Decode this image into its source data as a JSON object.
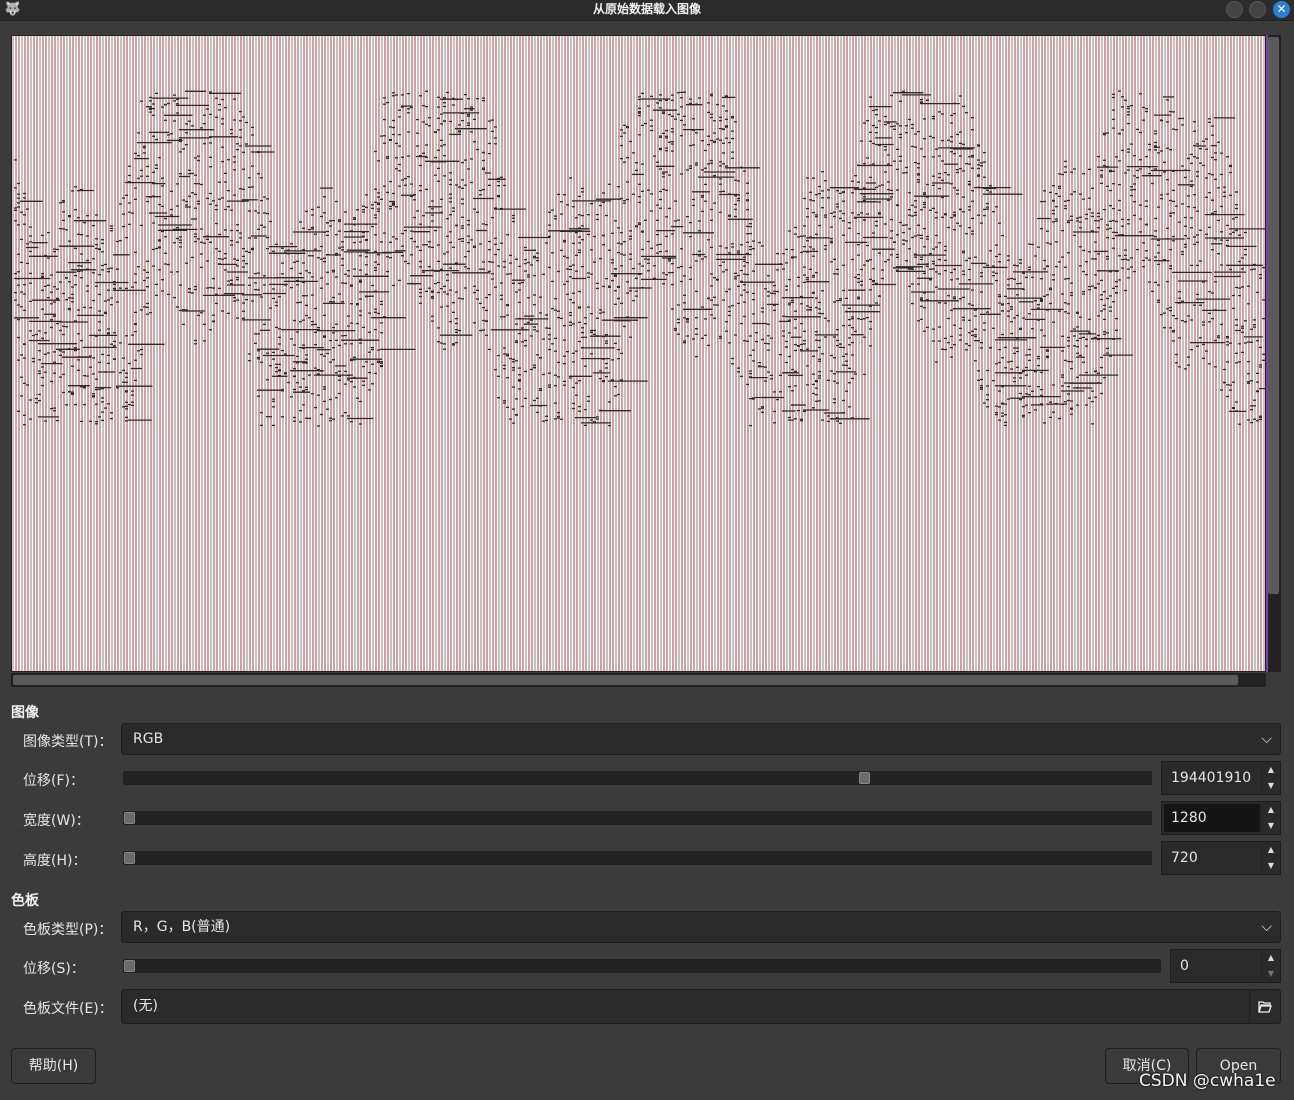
{
  "window": {
    "title": "从原始数据载入图像",
    "app_icon": "gimp-wilber-icon",
    "buttons": [
      "minimize",
      "maximize",
      "close"
    ],
    "close_symbol": "✕"
  },
  "preview": {
    "description": "raw-data-preview",
    "stripe_colors": [
      "#ffffff",
      "#8b0000",
      "#2a2a2a"
    ]
  },
  "image_section": {
    "title": "图像",
    "image_type": {
      "label": "图像类型(T)：",
      "value": "RGB",
      "chevron": "⌵"
    },
    "offset": {
      "label": "位移(F)：",
      "value": "194401910",
      "slider_fraction": 0.72
    },
    "width": {
      "label": "宽度(W)：",
      "value": "1280",
      "slider_fraction": 0.0
    },
    "height": {
      "label": "高度(H)：",
      "value": "720",
      "slider_fraction": 0.0
    }
  },
  "palette_section": {
    "title": "色板",
    "palette_type": {
      "label": "色板类型(P)：",
      "value": "R，G，B(普通)",
      "chevron": "⌵"
    },
    "offset": {
      "label": "位移(S)：",
      "value": "0",
      "slider_fraction": 0.0
    },
    "palette_file": {
      "label": "色板文件(E)：",
      "value": "(无)",
      "icon": "open-file-icon"
    }
  },
  "spinner_arrows": {
    "up": "▲",
    "down": "▼"
  },
  "footer": {
    "help_label": "帮助(H)",
    "cancel_label": "取消(C)",
    "open_label": "Open"
  },
  "watermark": "CSDN @cwha1e"
}
